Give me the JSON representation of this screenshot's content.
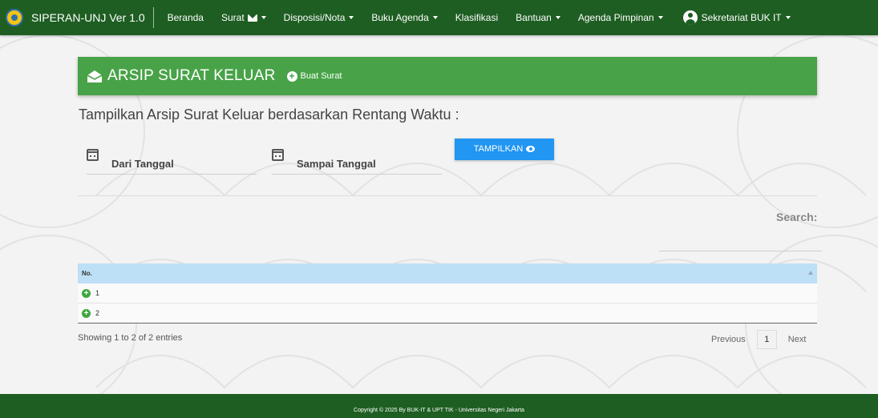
{
  "navbar": {
    "brand": "SIPERAN-UNJ Ver 1.0",
    "items": [
      {
        "label": "Beranda"
      },
      {
        "label": "Surat"
      },
      {
        "label": "Disposisi/Nota"
      },
      {
        "label": "Buku Agenda"
      },
      {
        "label": "Klasifikasi"
      },
      {
        "label": "Bantuan"
      },
      {
        "label": "Agenda Pimpinan"
      }
    ],
    "user": "Sekretariat BUK IT"
  },
  "header": {
    "title": "ARSIP SURAT KELUAR",
    "create_button": "Buat Surat"
  },
  "filter": {
    "title": "Tampilkan Arsip Surat Keluar berdasarkan Rentang Waktu :",
    "from_label": "Dari Tanggal",
    "to_label": "Sampai Tanggal",
    "show_button": "TAMPILKAN"
  },
  "table": {
    "search_label": "Search:",
    "columns": [
      "No."
    ],
    "rows": [
      {
        "no": "1"
      },
      {
        "no": "2"
      }
    ],
    "info": "Showing 1 to 2 of 2 entries",
    "pagination": {
      "previous": "Previous",
      "current": "1",
      "next": "Next"
    }
  },
  "footer": {
    "text": "Copyright © 2025 By BUK-IT & UPT TIK - Universitas Negeri Jakarta"
  },
  "colors": {
    "navbar": "#1e5e22",
    "header_card": "#48a348",
    "button_primary": "#2196f3",
    "table_header": "#bee0f7"
  }
}
